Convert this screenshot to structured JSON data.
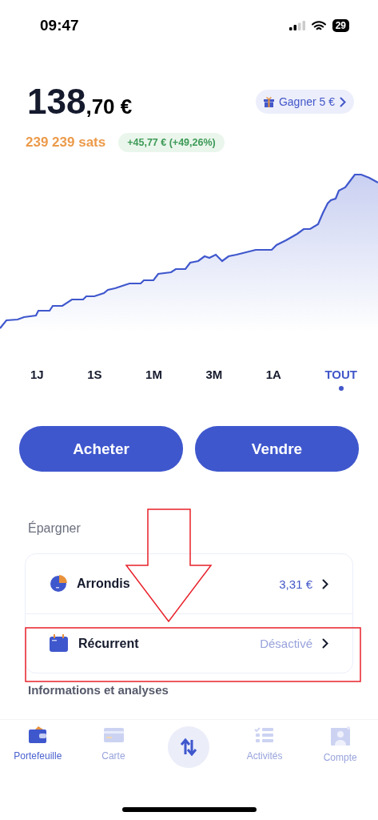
{
  "status_bar": {
    "time": "09:47",
    "battery": "29"
  },
  "balance": {
    "whole": "138",
    "decimals": ",70 €",
    "sats": "239 239 sats",
    "change": "+45,77 € (+49,26%)"
  },
  "promo": {
    "label": "Gagner 5 €"
  },
  "periods": [
    {
      "label": "1J",
      "selected": false
    },
    {
      "label": "1S",
      "selected": false
    },
    {
      "label": "1M",
      "selected": false
    },
    {
      "label": "3M",
      "selected": false
    },
    {
      "label": "1A",
      "selected": false
    },
    {
      "label": "TOUT",
      "selected": true
    }
  ],
  "actions": [
    "Acheter",
    "Vendre"
  ],
  "savings": {
    "title": "Épargner",
    "items": [
      {
        "kind": "roundup",
        "label": "Arrondis",
        "value": "3,31 €",
        "active": true
      },
      {
        "kind": "recurring",
        "label": "Récurrent",
        "value": "Désactivé",
        "active": false
      }
    ]
  },
  "next_section": "Informations et analyses",
  "tab_bar": [
    {
      "kind": "wallet",
      "label": "Portefeuille",
      "selected": true
    },
    {
      "kind": "card",
      "label": "Carte",
      "selected": false
    },
    {
      "kind": "swap"
    },
    {
      "kind": "activity",
      "label": "Activités",
      "selected": false
    },
    {
      "kind": "account",
      "label": "Compte",
      "selected": false
    }
  ]
}
